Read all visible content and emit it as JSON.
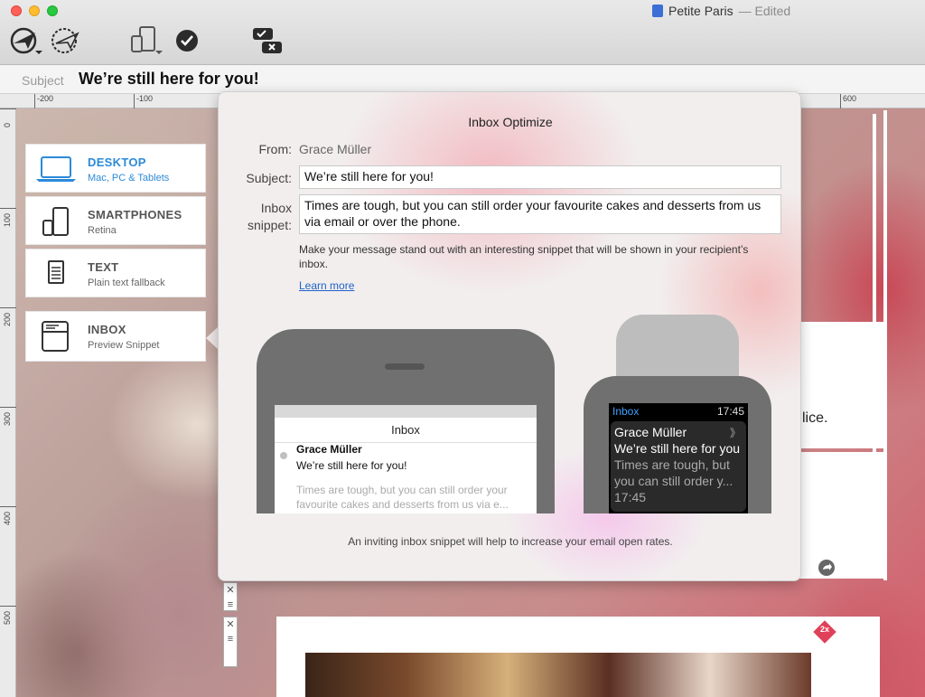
{
  "window": {
    "title": "Petite Paris",
    "status": "— Edited"
  },
  "toolbar": {
    "icons": [
      "send-options-icon",
      "schedule-icon",
      "device-preview-icon",
      "check-icon",
      "spam-check-icon"
    ]
  },
  "subject_bar": {
    "label": "Subject",
    "value": "We’re still here for you!"
  },
  "ruler": {
    "h_ticks": [
      "-200",
      "-100",
      "600"
    ],
    "v_ticks": [
      "0",
      "100",
      "200",
      "300",
      "400",
      "500"
    ]
  },
  "sidebar": {
    "items": [
      {
        "title": "DESKTOP",
        "subtitle": "Mac, PC & Tablets",
        "icon": "laptop-icon",
        "active": true
      },
      {
        "title": "SMARTPHONES",
        "subtitle": "Retina",
        "icon": "devices-icon",
        "active": false
      },
      {
        "title": "TEXT",
        "subtitle": "Plain text fallback",
        "icon": "text-doc-icon",
        "active": false
      },
      {
        "title": "INBOX",
        "subtitle": "Preview Snippet",
        "icon": "inbox-window-icon",
        "active": false
      }
    ]
  },
  "popover": {
    "title": "Inbox Optimize",
    "from_label": "From:",
    "from_value": "Grace Müller",
    "subject_label": "Subject:",
    "subject_value": "We’re still here for you!",
    "snippet_label_1": "Inbox",
    "snippet_label_2": "snippet:",
    "snippet_value": "Times are tough, but you can still order your favourite cakes and desserts from us via email or over the phone.",
    "hint": "Make your message stand out with an interesting snippet that will be shown in your recipient’s inbox.",
    "learn_more": "Learn more",
    "footer": "An inviting inbox snippet will help to increase your email open rates."
  },
  "phone_preview": {
    "header": "Inbox",
    "sender": "Grace Müller",
    "subject": "We’re still here for you!",
    "snippet_line1": "Times are tough, but you can still order your",
    "snippet_line2": "favourite cakes and desserts from us via e..."
  },
  "watch_preview": {
    "inbox": "Inbox",
    "time": "17:45",
    "sender": "Grace Müller",
    "subject": "We’re still here for you",
    "snippet_line1": "Times are tough, but",
    "snippet_line2": "you can still order y...",
    "time2": "17:45",
    "chevron": "》"
  },
  "canvas": {
    "partial_text": "lice.",
    "badge": "2x"
  },
  "colors": {
    "accent": "#2c8ad8",
    "link": "#1f62c8",
    "badge": "#e0415a"
  }
}
